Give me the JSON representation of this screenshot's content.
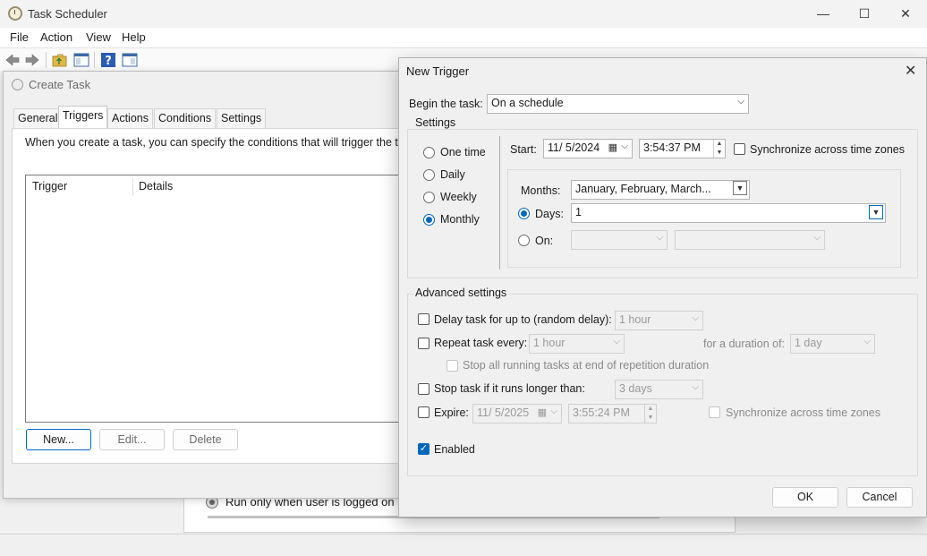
{
  "main_window": {
    "title": "Task Scheduler",
    "controls": {
      "minimize": "—",
      "maximize": "☐",
      "close": "✕"
    },
    "menu": [
      "File",
      "Action",
      "View",
      "Help"
    ],
    "background": {
      "radio_label": "Run only when user is logged on"
    }
  },
  "create_task": {
    "title": "Create Task",
    "tabs": [
      "General",
      "Triggers",
      "Actions",
      "Conditions",
      "Settings"
    ],
    "active_tab": "Triggers",
    "description": "When you create a task, you can specify the conditions that will trigger the task",
    "columns": [
      "Trigger",
      "Details"
    ],
    "buttons": {
      "new": "New...",
      "edit": "Edit...",
      "delete": "Delete"
    }
  },
  "new_trigger": {
    "title": "New Trigger",
    "close": "✕",
    "begin_label": "Begin the task:",
    "begin_value": "On a schedule",
    "settings_title": "Settings",
    "schedule_options": [
      "One time",
      "Daily",
      "Weekly",
      "Monthly"
    ],
    "selected_schedule": "Monthly",
    "start_label": "Start:",
    "start_date": "11/  5/2024",
    "start_time": "3:54:37 PM",
    "sync_label": "Synchronize across time zones",
    "months_label": "Months:",
    "months_value": "January, February, March...",
    "days_label": "Days:",
    "days_value": "1",
    "on_label": "On:",
    "advanced_title": "Advanced settings",
    "delay_label": "Delay task for up to (random delay):",
    "delay_value": "1 hour",
    "repeat_label": "Repeat task every:",
    "repeat_value": "1 hour",
    "duration_label": "for a duration of:",
    "duration_value": "1 day",
    "stop_running_label": "Stop all running tasks at end of repetition duration",
    "stop_longer_label": "Stop task if it runs longer than:",
    "stop_longer_value": "3 days",
    "expire_label": "Expire:",
    "expire_date": "11/  5/2025",
    "expire_time": "3:55:24 PM",
    "expire_sync_label": "Synchronize across time zones",
    "enabled_label": "Enabled",
    "enabled_checked": true,
    "ok": "OK",
    "cancel": "Cancel"
  },
  "colors": {
    "accent": "#0067c0",
    "window_bg": "#f0f0f0",
    "panel_bg": "#ffffff"
  }
}
